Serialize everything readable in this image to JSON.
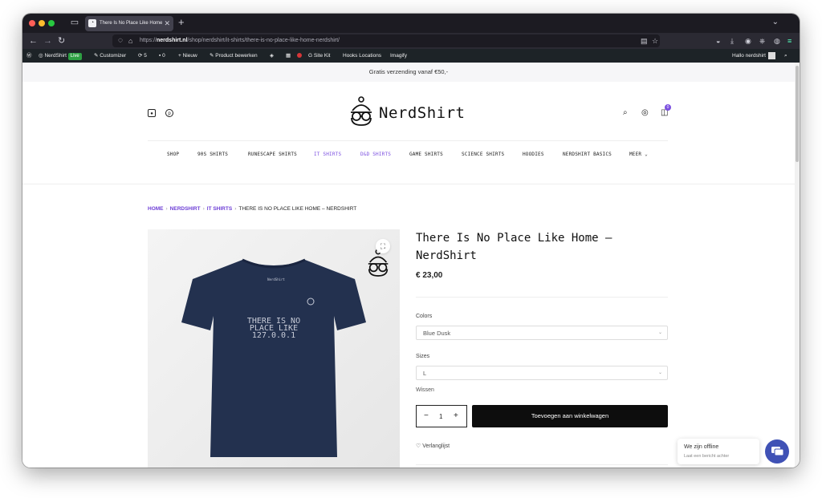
{
  "browser": {
    "tab_title": "There Is No Place Like Home – N",
    "url_prefix": "https://",
    "url_domain": "nerdshirt.nl",
    "url_path": "/shop/nerdshirt/it-shirts/there-is-no-place-like-home-nerdshirt/"
  },
  "adminbar": {
    "site_name": "NerdShirt",
    "live_badge": "Live",
    "customizer": "Customizer",
    "updates_count": "5",
    "comments_count": "0",
    "new_label": "Nieuw",
    "edit_product": "Product bewerken",
    "site_kit": "Site Kit",
    "hooks_locations": "Hooks Locations",
    "imagify": "Imagify",
    "greeting": "Hallo nerdshirt"
  },
  "promo": {
    "text": "Gratis verzending vanaf €50,-"
  },
  "header": {
    "logo_text": "NerdShirt",
    "cart_count": "0"
  },
  "menu": {
    "items": [
      {
        "label": "SHOP"
      },
      {
        "label": "90S SHIRTS"
      },
      {
        "label": "RUNESCAPE SHIRTS"
      },
      {
        "label": "IT SHIRTS"
      },
      {
        "label": "D&D SHIRTS"
      },
      {
        "label": "GAME SHIRTS"
      },
      {
        "label": "SCIENCE SHIRTS"
      },
      {
        "label": "HOODIES"
      },
      {
        "label": "NERDSHIRT BASICS"
      },
      {
        "label": "MEER"
      }
    ]
  },
  "breadcrumb": {
    "home": "HOME",
    "nerdshirt": "NERDSHIRT",
    "it_shirts": "IT SHIRTS",
    "current": "THERE IS NO PLACE LIKE HOME – NERDSHIRT"
  },
  "product": {
    "shirt_line1": "THERE IS NO",
    "shirt_line2": "PLACE LIKE",
    "shirt_line3": "127.0.0.1",
    "shirt_brand": "NerdShirt",
    "title": "There Is No Place Like Home – NerdShirt",
    "price": "€ 23,00",
    "colors_label": "Colors",
    "colors_value": "Blue Dusk",
    "sizes_label": "Sizes",
    "sizes_value": "L",
    "clear_label": "Wissen",
    "quantity": "1",
    "add_to_cart": "Toevoegen aan winkelwagen",
    "wishlist": "Verlanglijst"
  },
  "chat": {
    "title": "We zijn offline",
    "subtitle": "Laat een bericht achter"
  }
}
